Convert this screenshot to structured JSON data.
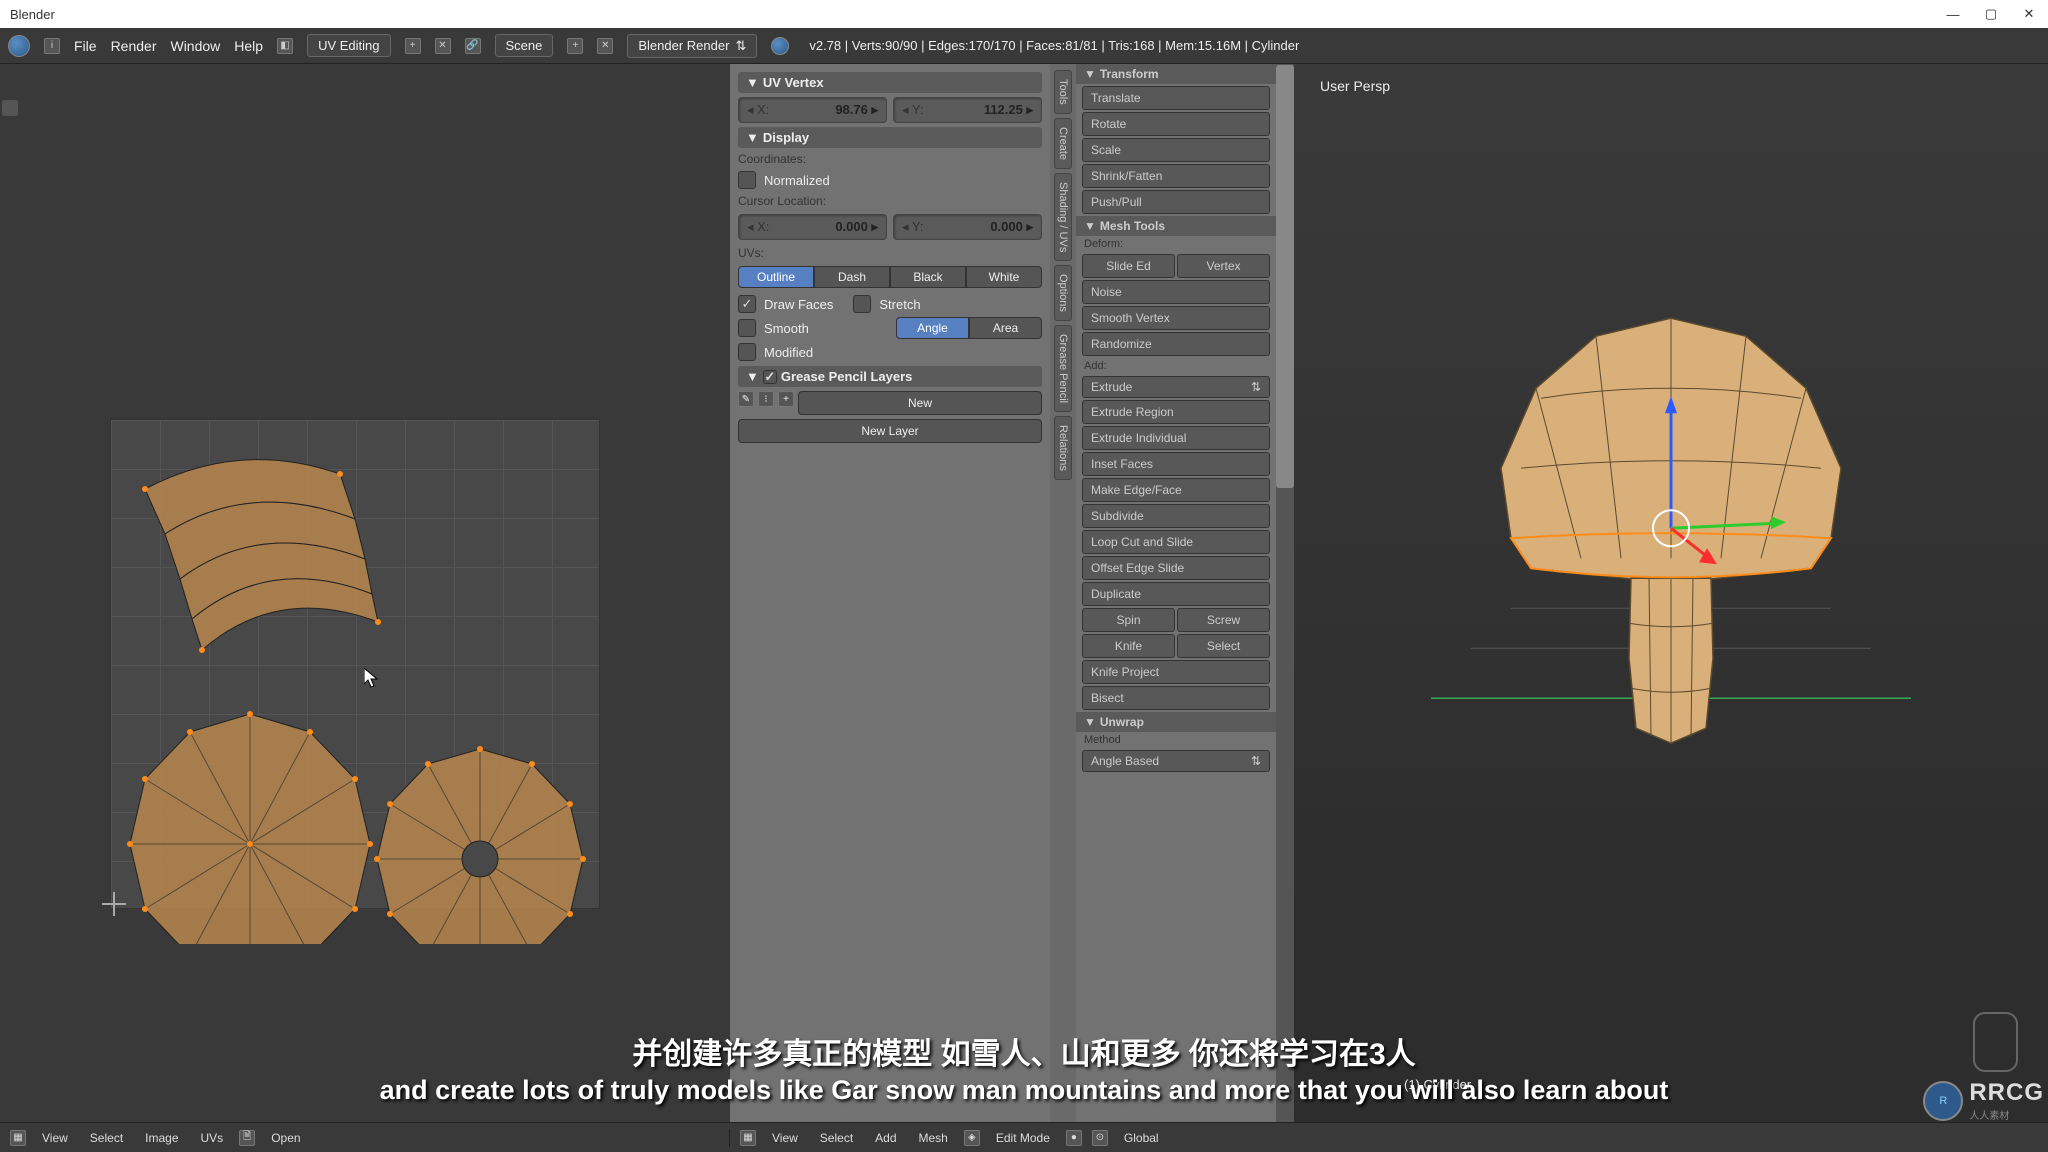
{
  "window": {
    "title": "Blender"
  },
  "topbar": {
    "menus": [
      "File",
      "Render",
      "Window",
      "Help"
    ],
    "layout": "UV Editing",
    "scene": "Scene",
    "engine": "Blender Render",
    "stats": "v2.78 | Verts:90/90 | Edges:170/170 | Faces:81/81 | Tris:168 | Mem:15.16M | Cylinder"
  },
  "npanel": {
    "uv_vertex": {
      "title": "UV Vertex",
      "x_label": "X:",
      "x": "98.76",
      "y_label": "Y:",
      "y": "112.25"
    },
    "display": {
      "title": "Display",
      "coords_label": "Coordinates:",
      "normalized": "Normalized",
      "cursor_label": "Cursor Location:",
      "cur_x_label": "X:",
      "cur_x": "0.000",
      "cur_y_label": "Y:",
      "cur_y": "0.000",
      "uvs_label": "UVs:",
      "seg": [
        "Outline",
        "Dash",
        "Black",
        "White"
      ],
      "draw_faces": "Draw Faces",
      "stretch": "Stretch",
      "smooth": "Smooth",
      "angle": "Angle",
      "area": "Area",
      "modified": "Modified"
    },
    "grease": {
      "title": "Grease Pencil Layers",
      "new": "New",
      "layer": "New Layer"
    }
  },
  "tooltabs": [
    "Tools",
    "Create",
    "Shading / UVs",
    "Options",
    "Grease Pencil",
    "Relations"
  ],
  "tshelf": {
    "transform": {
      "title": "Transform",
      "items": [
        "Translate",
        "Rotate",
        "Scale",
        "Shrink/Fatten",
        "Push/Pull"
      ]
    },
    "mesh": {
      "title": "Mesh Tools",
      "deform": "Deform:",
      "slide_ed": "Slide Ed",
      "vertex": "Vertex",
      "noise": "Noise",
      "smooth_v": "Smooth Vertex",
      "randomize": "Randomize",
      "add": "Add:",
      "extrude": "Extrude",
      "extrude_r": "Extrude Region",
      "extrude_i": "Extrude Individual",
      "inset": "Inset Faces",
      "make_ef": "Make Edge/Face",
      "subdiv": "Subdivide",
      "loop": "Loop Cut and Slide",
      "offset": "Offset Edge Slide",
      "dup": "Duplicate",
      "spin": "Spin",
      "screw": "Screw",
      "knife": "Knife",
      "select": "Select",
      "knife_p": "Knife Project",
      "bisect": "Bisect"
    },
    "unwrap": {
      "title": "Unwrap",
      "method": "Method",
      "angle": "Angle Based"
    }
  },
  "view3d": {
    "persp": "User Persp",
    "object": "(1) Cylinder"
  },
  "footer": {
    "left": [
      "View",
      "Select",
      "Image",
      "UVs",
      "Open"
    ],
    "right": [
      "View",
      "Select",
      "Add",
      "Mesh",
      "Edit Mode",
      "Global"
    ]
  },
  "subtitle": {
    "cn": "并创建许多真正的模型 如雪人、山和更多 你还将学习在3人",
    "en": "and create lots of truly models like Gar snow man mountains and more that you will also learn about"
  },
  "watermark": {
    "text": "RRCG",
    "sub": "人人素材"
  }
}
